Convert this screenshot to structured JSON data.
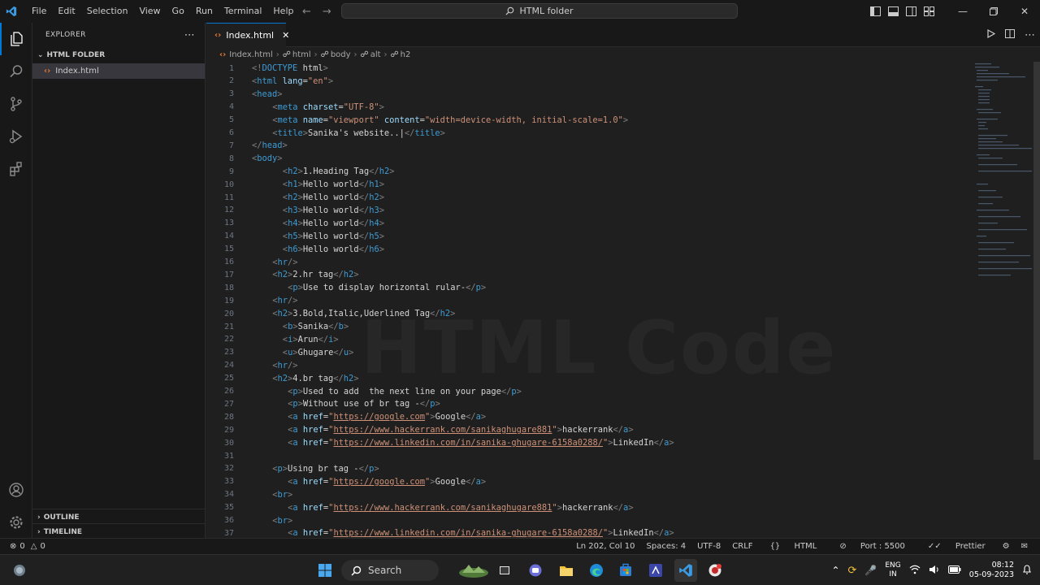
{
  "titlebar": {
    "menu": [
      "File",
      "Edit",
      "Selection",
      "View",
      "Go",
      "Run",
      "Terminal",
      "Help"
    ],
    "search_label": "HTML folder"
  },
  "sidebar": {
    "header": "EXPLORER",
    "folder": "HTML FOLDER",
    "file": "Index.html",
    "outline": "OUTLINE",
    "timeline": "TIMELINE"
  },
  "editor": {
    "tab_label": "Index.html",
    "breadcrumb": [
      "Index.html",
      "html",
      "body",
      "alt",
      "h2"
    ],
    "watermark": "HTML Code",
    "lines": [
      {
        "n": 1,
        "indent": 0,
        "parts": [
          [
            "br",
            "<!"
          ],
          [
            "tag",
            "DOCTYPE"
          ],
          [
            "txt",
            " html"
          ],
          [
            "br",
            ">"
          ]
        ]
      },
      {
        "n": 2,
        "indent": 0,
        "parts": [
          [
            "br",
            "<"
          ],
          [
            "tag",
            "html"
          ],
          [
            "attr",
            " lang"
          ],
          [
            "txt",
            "="
          ],
          [
            "str",
            "\"en\""
          ],
          [
            "br",
            ">"
          ]
        ]
      },
      {
        "n": 3,
        "indent": 0,
        "parts": [
          [
            "br",
            "<"
          ],
          [
            "tag",
            "head"
          ],
          [
            "br",
            ">"
          ]
        ]
      },
      {
        "n": 4,
        "indent": 4,
        "parts": [
          [
            "br",
            "<"
          ],
          [
            "tag",
            "meta"
          ],
          [
            "attr",
            " charset"
          ],
          [
            "txt",
            "="
          ],
          [
            "str",
            "\"UTF-8\""
          ],
          [
            "br",
            ">"
          ]
        ]
      },
      {
        "n": 5,
        "indent": 4,
        "parts": [
          [
            "br",
            "<"
          ],
          [
            "tag",
            "meta"
          ],
          [
            "attr",
            " name"
          ],
          [
            "txt",
            "="
          ],
          [
            "str",
            "\"viewport\""
          ],
          [
            "attr",
            " content"
          ],
          [
            "txt",
            "="
          ],
          [
            "str",
            "\"width=device-width, initial-scale=1.0\""
          ],
          [
            "br",
            ">"
          ]
        ]
      },
      {
        "n": 6,
        "indent": 4,
        "parts": [
          [
            "br",
            "<"
          ],
          [
            "tag",
            "title"
          ],
          [
            "br",
            ">"
          ],
          [
            "txt",
            "Sanika's website..|"
          ],
          [
            "br",
            "</"
          ],
          [
            "tag",
            "title"
          ],
          [
            "br",
            ">"
          ]
        ]
      },
      {
        "n": 7,
        "indent": 0,
        "parts": [
          [
            "br",
            "</"
          ],
          [
            "tag",
            "head"
          ],
          [
            "br",
            ">"
          ]
        ]
      },
      {
        "n": 8,
        "indent": 0,
        "parts": [
          [
            "br",
            "<"
          ],
          [
            "tag",
            "body"
          ],
          [
            "br",
            ">"
          ]
        ]
      },
      {
        "n": 9,
        "indent": 6,
        "parts": [
          [
            "br",
            "<"
          ],
          [
            "tag",
            "h2"
          ],
          [
            "br",
            ">"
          ],
          [
            "txt",
            "1.Heading Tag"
          ],
          [
            "br",
            "</"
          ],
          [
            "tag",
            "h2"
          ],
          [
            "br",
            ">"
          ]
        ]
      },
      {
        "n": 10,
        "indent": 6,
        "parts": [
          [
            "br",
            "<"
          ],
          [
            "tag",
            "h1"
          ],
          [
            "br",
            ">"
          ],
          [
            "txt",
            "Hello world"
          ],
          [
            "br",
            "</"
          ],
          [
            "tag",
            "h1"
          ],
          [
            "br",
            ">"
          ]
        ]
      },
      {
        "n": 11,
        "indent": 6,
        "parts": [
          [
            "br",
            "<"
          ],
          [
            "tag",
            "h2"
          ],
          [
            "br",
            ">"
          ],
          [
            "txt",
            "Hello world"
          ],
          [
            "br",
            "</"
          ],
          [
            "tag",
            "h2"
          ],
          [
            "br",
            ">"
          ]
        ]
      },
      {
        "n": 12,
        "indent": 6,
        "parts": [
          [
            "br",
            "<"
          ],
          [
            "tag",
            "h3"
          ],
          [
            "br",
            ">"
          ],
          [
            "txt",
            "Hello world"
          ],
          [
            "br",
            "</"
          ],
          [
            "tag",
            "h3"
          ],
          [
            "br",
            ">"
          ]
        ]
      },
      {
        "n": 13,
        "indent": 6,
        "parts": [
          [
            "br",
            "<"
          ],
          [
            "tag",
            "h4"
          ],
          [
            "br",
            ">"
          ],
          [
            "txt",
            "Hello world"
          ],
          [
            "br",
            "</"
          ],
          [
            "tag",
            "h4"
          ],
          [
            "br",
            ">"
          ]
        ]
      },
      {
        "n": 14,
        "indent": 6,
        "parts": [
          [
            "br",
            "<"
          ],
          [
            "tag",
            "h5"
          ],
          [
            "br",
            ">"
          ],
          [
            "txt",
            "Hello world"
          ],
          [
            "br",
            "</"
          ],
          [
            "tag",
            "h5"
          ],
          [
            "br",
            ">"
          ]
        ]
      },
      {
        "n": 15,
        "indent": 6,
        "parts": [
          [
            "br",
            "<"
          ],
          [
            "tag",
            "h6"
          ],
          [
            "br",
            ">"
          ],
          [
            "txt",
            "Hello world"
          ],
          [
            "br",
            "</"
          ],
          [
            "tag",
            "h6"
          ],
          [
            "br",
            ">"
          ]
        ]
      },
      {
        "n": 16,
        "indent": 4,
        "parts": [
          [
            "br",
            "<"
          ],
          [
            "tag",
            "hr"
          ],
          [
            "br",
            "/>"
          ]
        ]
      },
      {
        "n": 17,
        "indent": 4,
        "parts": [
          [
            "br",
            "<"
          ],
          [
            "tag",
            "h2"
          ],
          [
            "br",
            ">"
          ],
          [
            "txt",
            "2.hr tag"
          ],
          [
            "br",
            "</"
          ],
          [
            "tag",
            "h2"
          ],
          [
            "br",
            ">"
          ]
        ]
      },
      {
        "n": 18,
        "indent": 7,
        "parts": [
          [
            "br",
            "<"
          ],
          [
            "tag",
            "p"
          ],
          [
            "br",
            ">"
          ],
          [
            "txt",
            "Use to display horizontal rular-"
          ],
          [
            "br",
            "</"
          ],
          [
            "tag",
            "p"
          ],
          [
            "br",
            ">"
          ]
        ]
      },
      {
        "n": 19,
        "indent": 4,
        "parts": [
          [
            "br",
            "<"
          ],
          [
            "tag",
            "hr"
          ],
          [
            "br",
            "/>"
          ]
        ]
      },
      {
        "n": 20,
        "indent": 4,
        "parts": [
          [
            "br",
            "<"
          ],
          [
            "tag",
            "h2"
          ],
          [
            "br",
            ">"
          ],
          [
            "txt",
            "3.Bold,Italic,Uderlined Tag"
          ],
          [
            "br",
            "</"
          ],
          [
            "tag",
            "h2"
          ],
          [
            "br",
            ">"
          ]
        ]
      },
      {
        "n": 21,
        "indent": 6,
        "parts": [
          [
            "br",
            "<"
          ],
          [
            "tag",
            "b"
          ],
          [
            "br",
            ">"
          ],
          [
            "txt",
            "Sanika"
          ],
          [
            "br",
            "</"
          ],
          [
            "tag",
            "b"
          ],
          [
            "br",
            ">"
          ]
        ]
      },
      {
        "n": 22,
        "indent": 6,
        "parts": [
          [
            "br",
            "<"
          ],
          [
            "tag",
            "i"
          ],
          [
            "br",
            ">"
          ],
          [
            "txt",
            "Arun"
          ],
          [
            "br",
            "</"
          ],
          [
            "tag",
            "i"
          ],
          [
            "br",
            ">"
          ]
        ]
      },
      {
        "n": 23,
        "indent": 6,
        "parts": [
          [
            "br",
            "<"
          ],
          [
            "tag",
            "u"
          ],
          [
            "br",
            ">"
          ],
          [
            "txt",
            "Ghugare"
          ],
          [
            "br",
            "</"
          ],
          [
            "tag",
            "u"
          ],
          [
            "br",
            ">"
          ]
        ]
      },
      {
        "n": 24,
        "indent": 4,
        "parts": [
          [
            "br",
            "<"
          ],
          [
            "tag",
            "hr"
          ],
          [
            "br",
            "/>"
          ]
        ]
      },
      {
        "n": 25,
        "indent": 4,
        "parts": [
          [
            "br",
            "<"
          ],
          [
            "tag",
            "h2"
          ],
          [
            "br",
            ">"
          ],
          [
            "txt",
            "4.br tag"
          ],
          [
            "br",
            "</"
          ],
          [
            "tag",
            "h2"
          ],
          [
            "br",
            ">"
          ]
        ]
      },
      {
        "n": 26,
        "indent": 7,
        "parts": [
          [
            "br",
            "<"
          ],
          [
            "tag",
            "p"
          ],
          [
            "br",
            ">"
          ],
          [
            "txt",
            "Used to add  the next line on your page"
          ],
          [
            "br",
            "</"
          ],
          [
            "tag",
            "p"
          ],
          [
            "br",
            ">"
          ]
        ]
      },
      {
        "n": 27,
        "indent": 7,
        "parts": [
          [
            "br",
            "<"
          ],
          [
            "tag",
            "p"
          ],
          [
            "br",
            ">"
          ],
          [
            "txt",
            "Without use of br tag -"
          ],
          [
            "br",
            "</"
          ],
          [
            "tag",
            "p"
          ],
          [
            "br",
            ">"
          ]
        ]
      },
      {
        "n": 28,
        "indent": 7,
        "parts": [
          [
            "br",
            "<"
          ],
          [
            "tag",
            "a"
          ],
          [
            "attr",
            " href"
          ],
          [
            "txt",
            "="
          ],
          [
            "str",
            "\""
          ],
          [
            "link",
            "https://google.com"
          ],
          [
            "str",
            "\""
          ],
          [
            "br",
            ">"
          ],
          [
            "txt",
            "Google"
          ],
          [
            "br",
            "</"
          ],
          [
            "tag",
            "a"
          ],
          [
            "br",
            ">"
          ]
        ]
      },
      {
        "n": 29,
        "indent": 7,
        "parts": [
          [
            "br",
            "<"
          ],
          [
            "tag",
            "a"
          ],
          [
            "attr",
            " href"
          ],
          [
            "txt",
            "="
          ],
          [
            "str",
            "\""
          ],
          [
            "link",
            "https://www.hackerrank.com/sanikaghugare881"
          ],
          [
            "str",
            "\""
          ],
          [
            "br",
            ">"
          ],
          [
            "txt",
            "hackerrank"
          ],
          [
            "br",
            "</"
          ],
          [
            "tag",
            "a"
          ],
          [
            "br",
            ">"
          ]
        ]
      },
      {
        "n": 30,
        "indent": 7,
        "parts": [
          [
            "br",
            "<"
          ],
          [
            "tag",
            "a"
          ],
          [
            "attr",
            " href"
          ],
          [
            "txt",
            "="
          ],
          [
            "str",
            "\""
          ],
          [
            "link",
            "https://www.linkedin.com/in/sanika-ghugare-6158a0288/"
          ],
          [
            "str",
            "\""
          ],
          [
            "br",
            ">"
          ],
          [
            "txt",
            "LinkedIn"
          ],
          [
            "br",
            "</"
          ],
          [
            "tag",
            "a"
          ],
          [
            "br",
            ">"
          ]
        ]
      },
      {
        "n": 31,
        "indent": 0,
        "parts": []
      },
      {
        "n": 32,
        "indent": 4,
        "parts": [
          [
            "br",
            "<"
          ],
          [
            "tag",
            "p"
          ],
          [
            "br",
            ">"
          ],
          [
            "txt",
            "Using br tag -"
          ],
          [
            "br",
            "</"
          ],
          [
            "tag",
            "p"
          ],
          [
            "br",
            ">"
          ]
        ]
      },
      {
        "n": 33,
        "indent": 7,
        "parts": [
          [
            "br",
            "<"
          ],
          [
            "tag",
            "a"
          ],
          [
            "attr",
            " href"
          ],
          [
            "txt",
            "="
          ],
          [
            "str",
            "\""
          ],
          [
            "link",
            "https://google.com"
          ],
          [
            "str",
            "\""
          ],
          [
            "br",
            ">"
          ],
          [
            "txt",
            "Google"
          ],
          [
            "br",
            "</"
          ],
          [
            "tag",
            "a"
          ],
          [
            "br",
            ">"
          ]
        ]
      },
      {
        "n": 34,
        "indent": 4,
        "parts": [
          [
            "br",
            "<"
          ],
          [
            "tag",
            "br"
          ],
          [
            "br",
            ">"
          ]
        ]
      },
      {
        "n": 35,
        "indent": 7,
        "parts": [
          [
            "br",
            "<"
          ],
          [
            "tag",
            "a"
          ],
          [
            "attr",
            " href"
          ],
          [
            "txt",
            "="
          ],
          [
            "str",
            "\""
          ],
          [
            "link",
            "https://www.hackerrank.com/sanikaghugare881"
          ],
          [
            "str",
            "\""
          ],
          [
            "br",
            ">"
          ],
          [
            "txt",
            "hackerrank"
          ],
          [
            "br",
            "</"
          ],
          [
            "tag",
            "a"
          ],
          [
            "br",
            ">"
          ]
        ]
      },
      {
        "n": 36,
        "indent": 4,
        "parts": [
          [
            "br",
            "<"
          ],
          [
            "tag",
            "br"
          ],
          [
            "br",
            ">"
          ]
        ]
      },
      {
        "n": 37,
        "indent": 7,
        "parts": [
          [
            "br",
            "<"
          ],
          [
            "tag",
            "a"
          ],
          [
            "attr",
            " href"
          ],
          [
            "txt",
            "="
          ],
          [
            "str",
            "\""
          ],
          [
            "link",
            "https://www.linkedin.com/in/sanika-ghugare-6158a0288/"
          ],
          [
            "str",
            "\""
          ],
          [
            "br",
            ">"
          ],
          [
            "txt",
            "LinkedIn"
          ],
          [
            "br",
            "</"
          ],
          [
            "tag",
            "a"
          ],
          [
            "br",
            ">"
          ]
        ]
      }
    ]
  },
  "status": {
    "errors": "0",
    "warnings": "0",
    "position": "Ln 202, Col 10",
    "spaces": "Spaces: 4",
    "encoding": "UTF-8",
    "eol": "CRLF",
    "language": "HTML",
    "port": "Port : 5500",
    "formatter": "Prettier"
  },
  "taskbar": {
    "search_label": "Search",
    "lang_top": "ENG",
    "lang_bottom": "IN",
    "time": "08:12",
    "date": "05-09-2023"
  },
  "colors": {
    "accent": "#0078d4",
    "tag": "#3c9cd6",
    "attribute": "#9cdcfe",
    "string": "#ce9178"
  }
}
